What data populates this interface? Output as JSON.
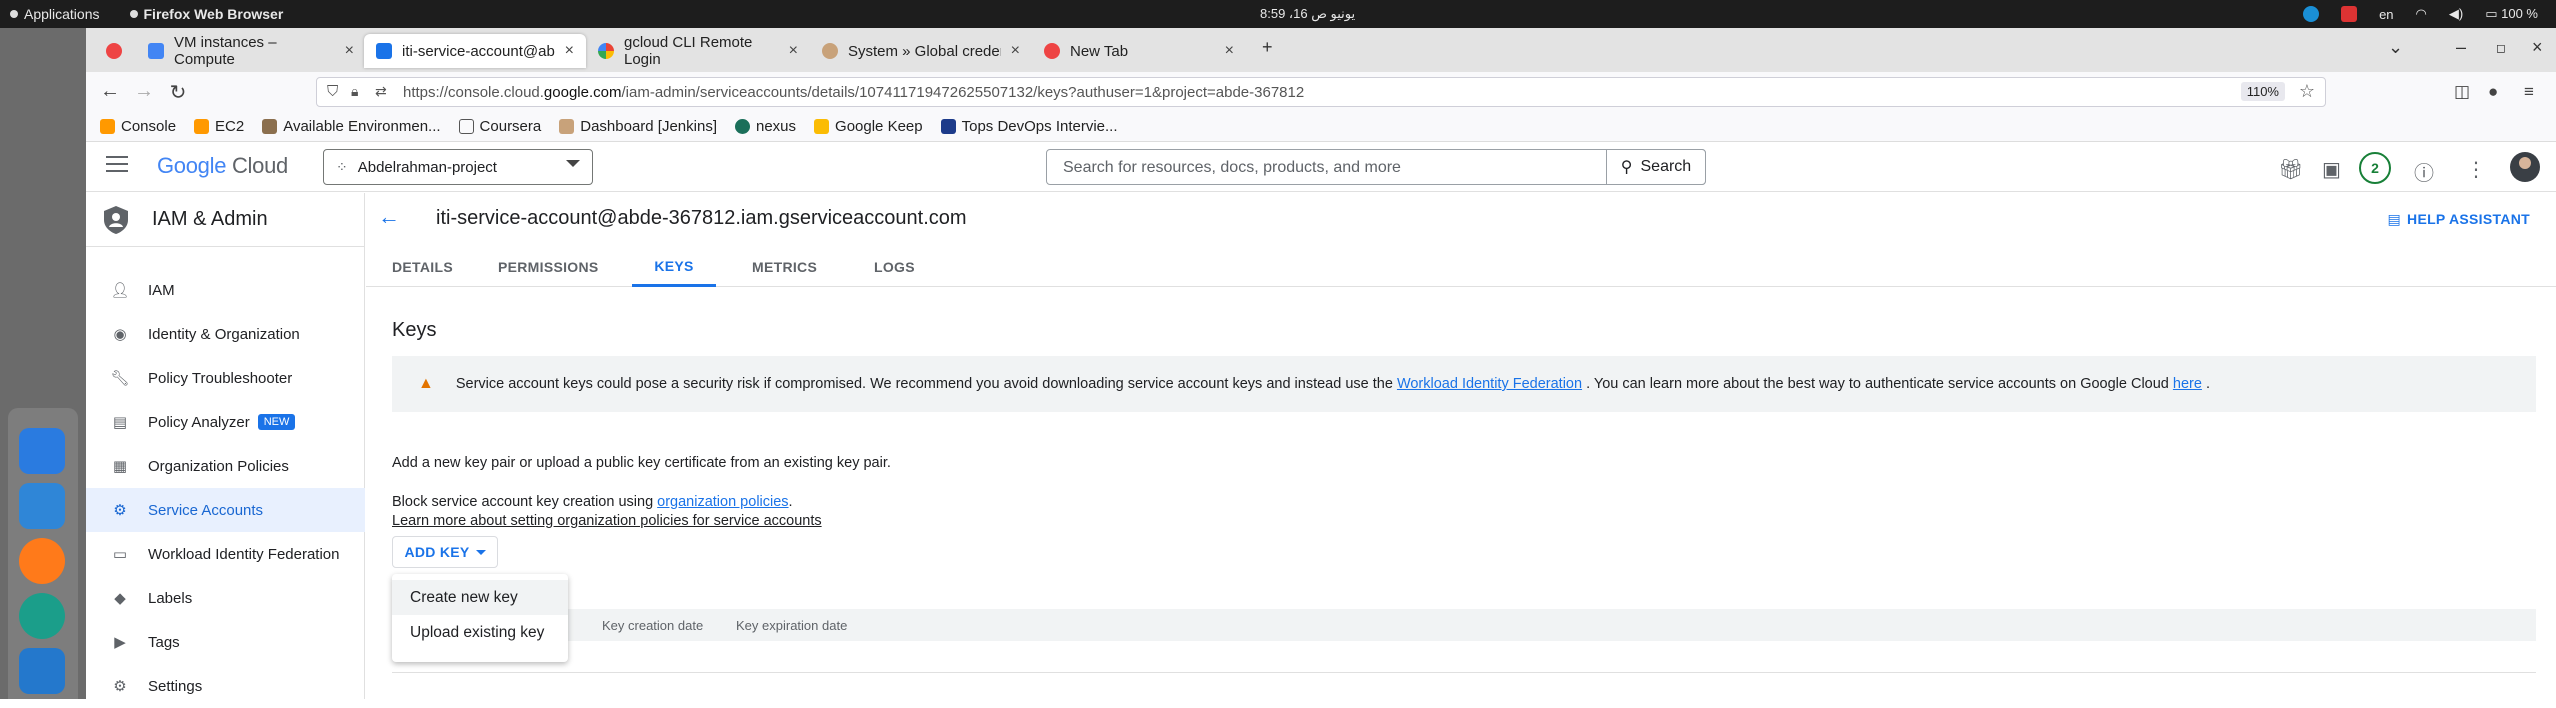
{
  "os": {
    "applications": "Applications",
    "active_app": "Firefox Web Browser",
    "clock": "8:59 ،16 يونيو ص",
    "lang": "en",
    "battery": "100 %"
  },
  "browser": {
    "tabs": [
      {
        "label": "VM instances – Compute",
        "active": false
      },
      {
        "label": "iti-service-account@abde",
        "active": true
      },
      {
        "label": "gcloud CLI Remote Login",
        "active": false
      },
      {
        "label": "System » Global credenti",
        "active": false
      },
      {
        "label": "New Tab",
        "active": false
      }
    ],
    "url_prefix": "https://console.cloud.",
    "url_domain": "google.com",
    "url_suffix": "/iam-admin/serviceaccounts/details/107411719472625507132/keys?authuser=1&project=abde-367812",
    "zoom": "110%",
    "bookmarks": [
      "Console",
      "EC2",
      "Available Environmen...",
      "Coursera",
      "Dashboard [Jenkins]",
      "nexus",
      "Google Keep",
      "Tops DevOps Intervie..."
    ]
  },
  "console": {
    "logo_google": "Google",
    "logo_cloud": " Cloud",
    "project": "Abdelrahman-project",
    "search_placeholder": "Search for resources, docs, products, and more",
    "search_button": "Search",
    "notifications_count": "2"
  },
  "sidebar": {
    "title": "IAM & Admin",
    "items": [
      {
        "label": "IAM",
        "icon": "person-add-icon"
      },
      {
        "label": "Identity & Organization",
        "icon": "account-circle-icon"
      },
      {
        "label": "Policy Troubleshooter",
        "icon": "wrench-icon"
      },
      {
        "label": "Policy Analyzer",
        "icon": "document-search-icon",
        "badge": "NEW"
      },
      {
        "label": "Organization Policies",
        "icon": "list-doc-icon"
      },
      {
        "label": "Service Accounts",
        "icon": "service-account-icon",
        "active": true
      },
      {
        "label": "Workload Identity Federation",
        "icon": "id-card-icon"
      },
      {
        "label": "Labels",
        "icon": "label-icon"
      },
      {
        "label": "Tags",
        "icon": "tag-icon"
      },
      {
        "label": "Settings",
        "icon": "gear-icon"
      }
    ]
  },
  "main": {
    "title": "iti-service-account@abde-367812.iam.gserviceaccount.com",
    "help": "HELP ASSISTANT",
    "tabs": [
      "DETAILS",
      "PERMISSIONS",
      "KEYS",
      "METRICS",
      "LOGS"
    ],
    "active_tab": "KEYS",
    "keys_heading": "Keys",
    "warning_pre": "Service account keys could pose a security risk if compromised. We recommend you avoid downloading service account keys and instead use the ",
    "warning_link1": "Workload Identity Federation",
    "warning_mid": " . You can learn more about the best way to authenticate service accounts on Google Cloud ",
    "warning_link2": "here",
    "warning_end": " .",
    "add_pair_text": "Add a new key pair or upload a public key certificate from an existing key pair.",
    "block_pre": "Block service account key creation using ",
    "block_link": "organization policies",
    "block_end": ".",
    "learn_link": "Learn more about setting organization policies for service accounts",
    "add_key": "ADD KEY",
    "dropdown": [
      "Create new key",
      "Upload existing key"
    ],
    "table_headers": [
      "Key creation date",
      "Key expiration date"
    ]
  }
}
